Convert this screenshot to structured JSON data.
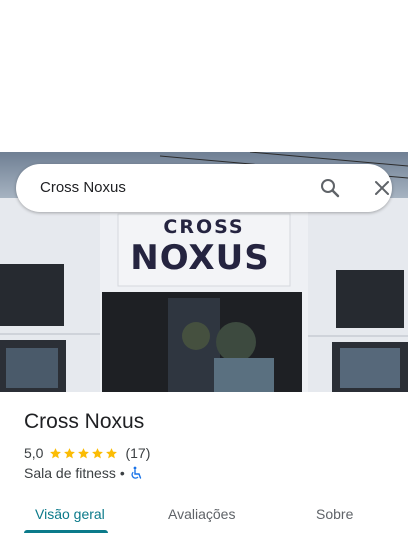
{
  "search": {
    "query": "Cross Noxus"
  },
  "hero": {
    "sign_line1": "CROSS",
    "sign_line2": "NOXUS"
  },
  "place": {
    "name": "Cross Noxus",
    "rating": "5,0",
    "stars": 5,
    "review_count": "(17)",
    "category": "Sala de fitness",
    "separator": "•"
  },
  "tabs": [
    {
      "label": "Visão geral",
      "active": true
    },
    {
      "label": "Avaliações",
      "active": false
    },
    {
      "label": "Sobre",
      "active": false
    }
  ],
  "colors": {
    "accent": "#0b7a8a",
    "star": "#fbbc04",
    "accessibility": "#1a73e8"
  }
}
